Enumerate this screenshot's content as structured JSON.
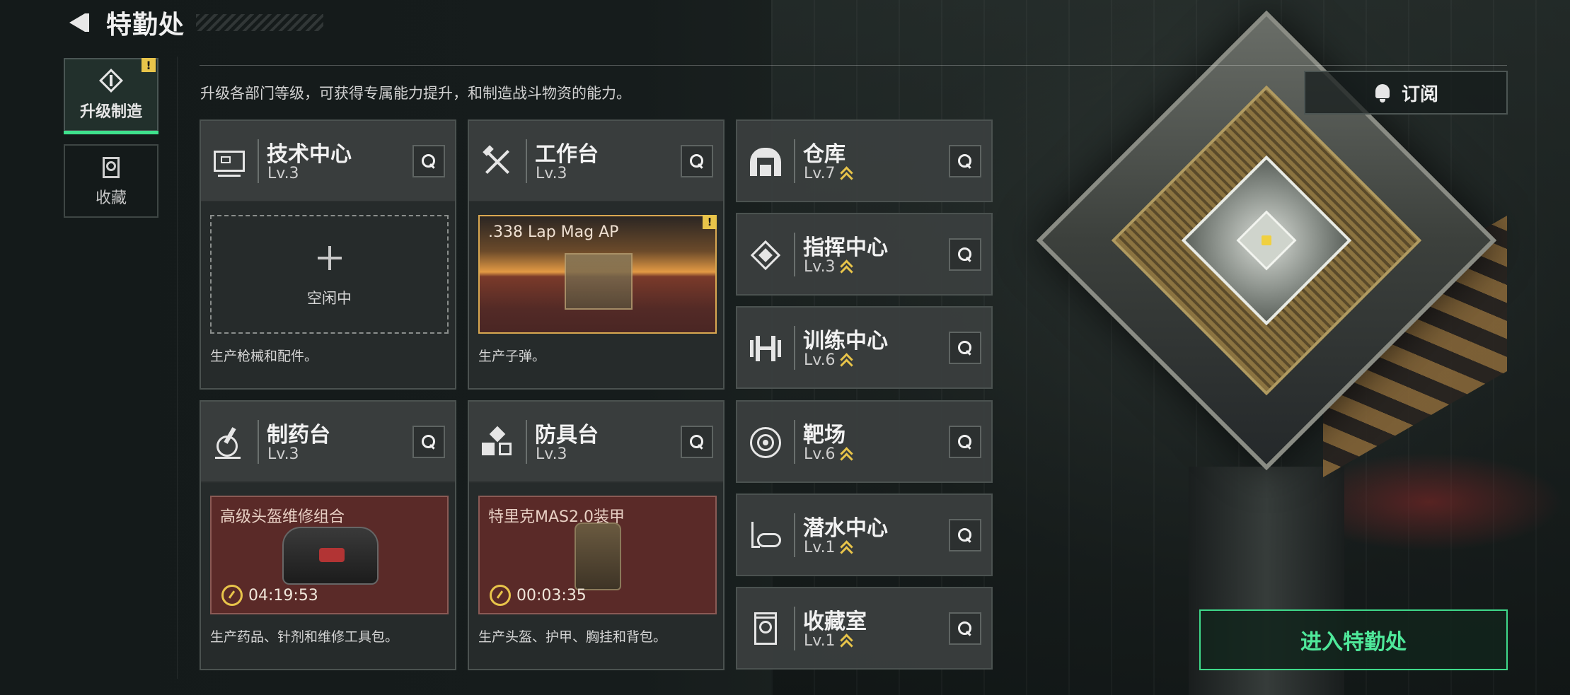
{
  "header": {
    "title": "特勤处"
  },
  "tabs": [
    {
      "label": "升级制造",
      "active": true,
      "warn": "!"
    },
    {
      "label": "收藏",
      "active": false
    }
  ],
  "description": "升级各部门等级，可获得专属能力提升，和制造战斗物资的能力。",
  "subscribe_label": "订阅",
  "enter_label": "进入特勤处",
  "workshops": [
    {
      "name": "技术中心",
      "level": "Lv.3",
      "icon": "computer-icon",
      "slot": {
        "state": "idle",
        "text": "空闲中"
      },
      "desc": "生产枪械和配件。"
    },
    {
      "name": "工作台",
      "level": "Lv.3",
      "icon": "tools-icon",
      "slot": {
        "state": "ready",
        "text": ".338 Lap Mag AP",
        "warn": "!"
      },
      "desc": "生产子弹。"
    },
    {
      "name": "制药台",
      "level": "Lv.3",
      "icon": "microscope-icon",
      "slot": {
        "state": "producing",
        "text": "高级头盔维修组合",
        "timer": "04:19:53"
      },
      "desc": "生产药品、针剂和维修工具包。"
    },
    {
      "name": "防具台",
      "level": "Lv.3",
      "icon": "cubes-icon",
      "slot": {
        "state": "producing",
        "text": "特里克MAS2.0装甲",
        "timer": "00:03:35"
      },
      "desc": "生产头盔、护甲、胸挂和背包。"
    }
  ],
  "facilities": [
    {
      "name": "仓库",
      "level": "Lv.7",
      "icon": "warehouse-icon",
      "upgradable": true
    },
    {
      "name": "指挥中心",
      "level": "Lv.3",
      "icon": "chip-icon",
      "upgradable": true
    },
    {
      "name": "训练中心",
      "level": "Lv.6",
      "icon": "dumbbell-icon",
      "upgradable": true
    },
    {
      "name": "靶场",
      "level": "Lv.6",
      "icon": "target-icon",
      "upgradable": true
    },
    {
      "name": "潜水中心",
      "level": "Lv.1",
      "icon": "diving-mask-icon",
      "upgradable": true
    },
    {
      "name": "收藏室",
      "level": "Lv.1",
      "icon": "collection-icon",
      "upgradable": true
    }
  ],
  "colors": {
    "accent_green": "#3fe08c",
    "warn_yellow": "#e8c44a",
    "card_bg": "#3a3e3e"
  }
}
